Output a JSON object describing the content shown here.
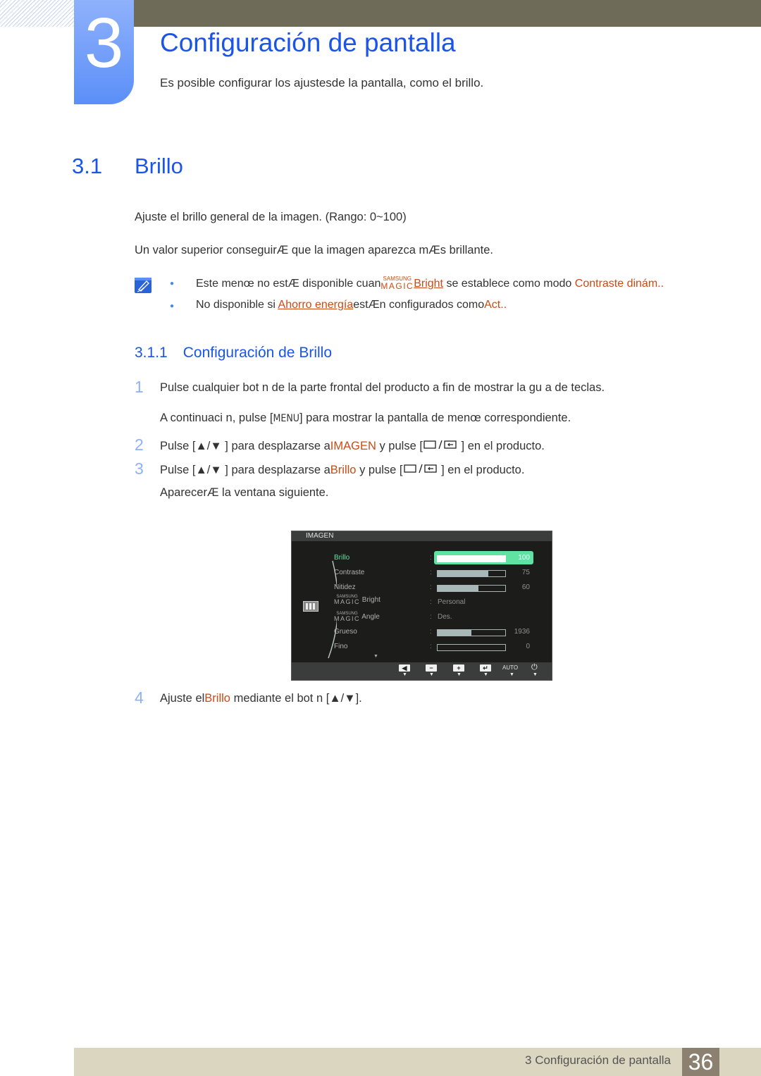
{
  "chapter": {
    "number": "3",
    "title": "Configuración de pantalla",
    "subtitle": "Es posible configurar los ajustesde la pantalla, como el brillo."
  },
  "section": {
    "number": "3.1",
    "title": "Brillo",
    "paragraphs": [
      "Ajuste el brillo general de la imagen. (Rango: 0~100)",
      "Un valor superior conseguirÆ que la imagen aparezca mÆs brillante."
    ],
    "notes": [
      {
        "prefix": "Este menœ no estÆ disponible cuan",
        "magic_top": "SAMSUNG",
        "magic_bottom": "MAGIC",
        "link": "Bright",
        "middle": " se establece como modo ",
        "value": "Contraste dinám..",
        "suffix": ""
      },
      {
        "prefix": "No disponible si ",
        "link": "Ahorro energía",
        "middle": "estÆn configurados como",
        "value": "Act..",
        "suffix": ""
      }
    ]
  },
  "subsection": {
    "number": "3.1.1",
    "title": "Configuración de Brillo",
    "steps": [
      {
        "number": "1",
        "text": "Pulse cualquier bot n de la parte frontal del producto a fin de mostrar la gu a de teclas.",
        "continuation_prefix": "A continuaci n, pulse [",
        "menu_key": "MENU",
        "continuation_suffix": "] para mostrar la pantalla de menœ correspondiente."
      },
      {
        "number": "2",
        "prefix": "Pulse [",
        "mid": " ] para desplazarse a",
        "target": "IMAGEN",
        "mid2": " y pulse [",
        "suffix": " ] en el producto."
      },
      {
        "number": "3",
        "prefix": "Pulse [",
        "mid": " ] para desplazarse a",
        "target": "Brillo",
        "mid2": " y pulse [",
        "suffix": " ] en el producto.",
        "after": "AparecerÆ la ventana siguiente."
      },
      {
        "number": "4",
        "prefix": "Ajuste el",
        "target": "Brillo",
        "suffix": " mediante el bot n [",
        "end": "]."
      }
    ]
  },
  "osd": {
    "header": "IMAGEN",
    "items": [
      {
        "label": "Brillo",
        "type": "bar",
        "value": "100",
        "fraction": 1.0,
        "active": true
      },
      {
        "label": "Contraste",
        "type": "bar",
        "value": "75",
        "fraction": 0.75
      },
      {
        "label": "Nitidez",
        "type": "bar",
        "value": "60",
        "fraction": 0.6
      },
      {
        "magic_top": "SAMSUNG",
        "magic_bottom": "MAGIC",
        "label": "Bright",
        "type": "text",
        "value": "Personal"
      },
      {
        "magic_top": "SAMSUNG",
        "magic_bottom": "MAGIC",
        "label": "Angle",
        "type": "text",
        "value": "Des."
      },
      {
        "label": "Grueso",
        "type": "bar",
        "value": "1936",
        "fraction": 0.5
      },
      {
        "label": "Fino",
        "type": "bar",
        "value": "0",
        "fraction": 0.0
      }
    ],
    "footer_buttons": [
      {
        "name": "left",
        "glyph": "◀"
      },
      {
        "name": "minus",
        "glyph": "−"
      },
      {
        "name": "plus",
        "glyph": "+"
      },
      {
        "name": "enter",
        "glyph": "↵"
      },
      {
        "name": "auto",
        "glyph": "AUTO"
      },
      {
        "name": "power",
        "glyph": "⏻"
      }
    ]
  },
  "footer": {
    "title": "3 Configuración de pantalla",
    "page": "36"
  },
  "colors": {
    "heading_blue": "#1a55e8",
    "link_orange": "#cc4a14",
    "osd_active": "#5fe2a2",
    "topbar": "#6e6b58",
    "footer_bg": "#dad6c0",
    "page_box": "#8c8070"
  }
}
